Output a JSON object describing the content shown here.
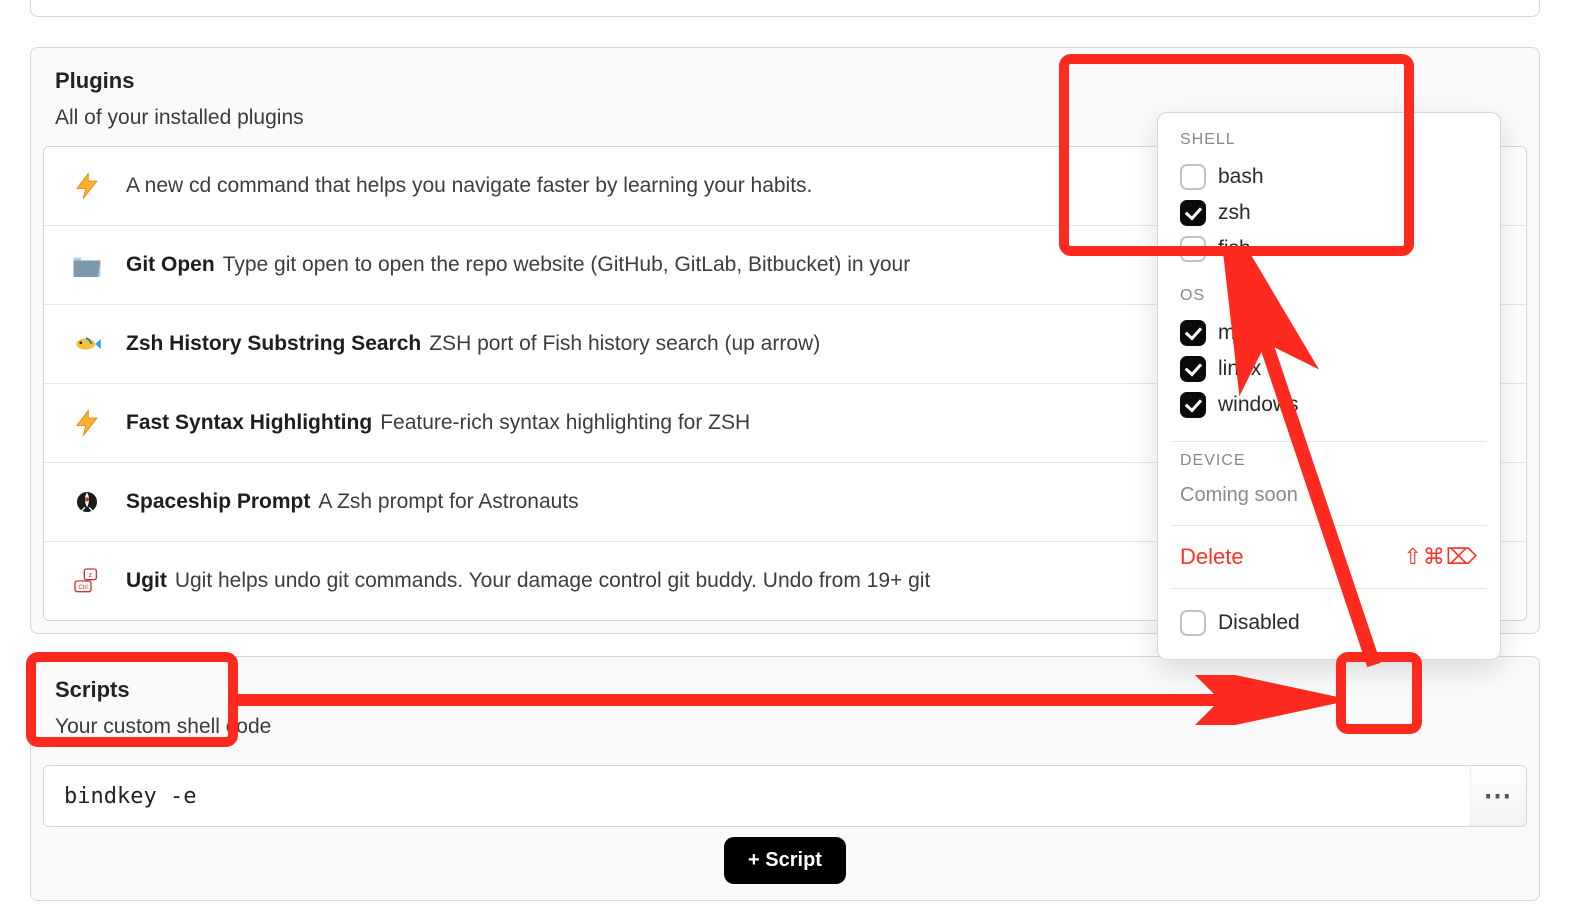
{
  "plugins_section": {
    "title": "Plugins",
    "subtitle": "All of your installed plugins",
    "items": [
      {
        "icon": "lightning",
        "name": "",
        "desc": "A new cd command that helps you navigate faster by learning your habits."
      },
      {
        "icon": "folder",
        "name": "Git Open",
        "desc": "Type git open to open the repo website (GitHub, GitLab, Bitbucket) in your"
      },
      {
        "icon": "fish",
        "name": "Zsh History Substring Search",
        "desc": "ZSH port of Fish history search (up arrow)"
      },
      {
        "icon": "lightning",
        "name": "Fast Syntax Highlighting",
        "desc": "Feature-rich syntax highlighting for ZSH"
      },
      {
        "icon": "rocket",
        "name": "Spaceship Prompt",
        "desc": "A Zsh prompt for Astronauts"
      },
      {
        "icon": "keycaps",
        "name": "Ugit",
        "desc": "Ugit helps undo git commands. Your damage control git buddy. Undo from 19+ git"
      }
    ]
  },
  "options_panel": {
    "shell": {
      "heading": "SHELL",
      "items": [
        {
          "label": "bash",
          "checked": false
        },
        {
          "label": "zsh",
          "checked": true
        },
        {
          "label": "fish",
          "checked": false
        }
      ]
    },
    "os": {
      "heading": "OS",
      "items": [
        {
          "label": "macos",
          "checked": true
        },
        {
          "label": "linux",
          "checked": true
        },
        {
          "label": "windows",
          "checked": true
        }
      ]
    },
    "device": {
      "heading": "DEVICE",
      "coming_soon": "Coming soon"
    },
    "delete": {
      "label": "Delete",
      "shortcut": "⇧⌘⌦"
    },
    "disabled": {
      "label": "Disabled",
      "checked": false
    }
  },
  "scripts_section": {
    "title": "Scripts",
    "subtitle": "Your custom shell code",
    "rows": [
      {
        "code": "bindkey -e"
      }
    ],
    "add_button": "+ Script"
  }
}
